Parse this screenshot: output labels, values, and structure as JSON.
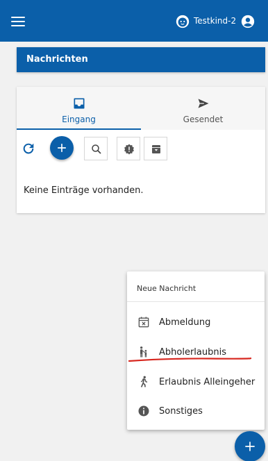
{
  "header": {
    "menu_icon": "hamburger-icon",
    "child_icon": "child-face-icon",
    "child_name": "Testkind-2",
    "account_icon": "account-circle-icon",
    "color": "#0b5fa9"
  },
  "section": {
    "title": "Nachrichten"
  },
  "tabs": [
    {
      "label": "Eingang",
      "icon": "inbox-icon",
      "active": true
    },
    {
      "label": "Gesendet",
      "icon": "send-icon",
      "active": false
    }
  ],
  "toolbar": {
    "refresh_icon": "refresh-icon",
    "add_icon": "plus-icon",
    "search_icon": "search-icon",
    "important_icon": "alert-badge-icon",
    "archive_icon": "archive-icon"
  },
  "list": {
    "empty_text": "Keine Einträge vorhanden."
  },
  "new_message_menu": {
    "title": "Neue Nachricht",
    "items": [
      {
        "label": "Abmeldung",
        "icon": "calendar-x-icon"
      },
      {
        "label": "Abholerlaubnis",
        "icon": "pickup-people-icon"
      },
      {
        "label": "Erlaubnis Alleingeher",
        "icon": "walking-icon"
      },
      {
        "label": "Sonstiges",
        "icon": "info-icon"
      }
    ]
  },
  "fab": {
    "icon": "plus-icon"
  }
}
